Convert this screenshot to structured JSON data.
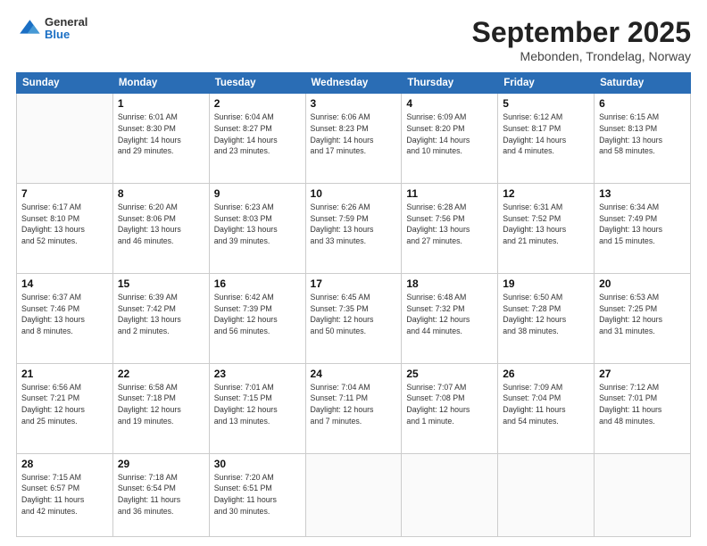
{
  "header": {
    "logo_general": "General",
    "logo_blue": "Blue",
    "month": "September 2025",
    "location": "Mebonden, Trondelag, Norway"
  },
  "weekdays": [
    "Sunday",
    "Monday",
    "Tuesday",
    "Wednesday",
    "Thursday",
    "Friday",
    "Saturday"
  ],
  "weeks": [
    [
      {
        "day": "",
        "info": ""
      },
      {
        "day": "1",
        "info": "Sunrise: 6:01 AM\nSunset: 8:30 PM\nDaylight: 14 hours\nand 29 minutes."
      },
      {
        "day": "2",
        "info": "Sunrise: 6:04 AM\nSunset: 8:27 PM\nDaylight: 14 hours\nand 23 minutes."
      },
      {
        "day": "3",
        "info": "Sunrise: 6:06 AM\nSunset: 8:23 PM\nDaylight: 14 hours\nand 17 minutes."
      },
      {
        "day": "4",
        "info": "Sunrise: 6:09 AM\nSunset: 8:20 PM\nDaylight: 14 hours\nand 10 minutes."
      },
      {
        "day": "5",
        "info": "Sunrise: 6:12 AM\nSunset: 8:17 PM\nDaylight: 14 hours\nand 4 minutes."
      },
      {
        "day": "6",
        "info": "Sunrise: 6:15 AM\nSunset: 8:13 PM\nDaylight: 13 hours\nand 58 minutes."
      }
    ],
    [
      {
        "day": "7",
        "info": "Sunrise: 6:17 AM\nSunset: 8:10 PM\nDaylight: 13 hours\nand 52 minutes."
      },
      {
        "day": "8",
        "info": "Sunrise: 6:20 AM\nSunset: 8:06 PM\nDaylight: 13 hours\nand 46 minutes."
      },
      {
        "day": "9",
        "info": "Sunrise: 6:23 AM\nSunset: 8:03 PM\nDaylight: 13 hours\nand 39 minutes."
      },
      {
        "day": "10",
        "info": "Sunrise: 6:26 AM\nSunset: 7:59 PM\nDaylight: 13 hours\nand 33 minutes."
      },
      {
        "day": "11",
        "info": "Sunrise: 6:28 AM\nSunset: 7:56 PM\nDaylight: 13 hours\nand 27 minutes."
      },
      {
        "day": "12",
        "info": "Sunrise: 6:31 AM\nSunset: 7:52 PM\nDaylight: 13 hours\nand 21 minutes."
      },
      {
        "day": "13",
        "info": "Sunrise: 6:34 AM\nSunset: 7:49 PM\nDaylight: 13 hours\nand 15 minutes."
      }
    ],
    [
      {
        "day": "14",
        "info": "Sunrise: 6:37 AM\nSunset: 7:46 PM\nDaylight: 13 hours\nand 8 minutes."
      },
      {
        "day": "15",
        "info": "Sunrise: 6:39 AM\nSunset: 7:42 PM\nDaylight: 13 hours\nand 2 minutes."
      },
      {
        "day": "16",
        "info": "Sunrise: 6:42 AM\nSunset: 7:39 PM\nDaylight: 12 hours\nand 56 minutes."
      },
      {
        "day": "17",
        "info": "Sunrise: 6:45 AM\nSunset: 7:35 PM\nDaylight: 12 hours\nand 50 minutes."
      },
      {
        "day": "18",
        "info": "Sunrise: 6:48 AM\nSunset: 7:32 PM\nDaylight: 12 hours\nand 44 minutes."
      },
      {
        "day": "19",
        "info": "Sunrise: 6:50 AM\nSunset: 7:28 PM\nDaylight: 12 hours\nand 38 minutes."
      },
      {
        "day": "20",
        "info": "Sunrise: 6:53 AM\nSunset: 7:25 PM\nDaylight: 12 hours\nand 31 minutes."
      }
    ],
    [
      {
        "day": "21",
        "info": "Sunrise: 6:56 AM\nSunset: 7:21 PM\nDaylight: 12 hours\nand 25 minutes."
      },
      {
        "day": "22",
        "info": "Sunrise: 6:58 AM\nSunset: 7:18 PM\nDaylight: 12 hours\nand 19 minutes."
      },
      {
        "day": "23",
        "info": "Sunrise: 7:01 AM\nSunset: 7:15 PM\nDaylight: 12 hours\nand 13 minutes."
      },
      {
        "day": "24",
        "info": "Sunrise: 7:04 AM\nSunset: 7:11 PM\nDaylight: 12 hours\nand 7 minutes."
      },
      {
        "day": "25",
        "info": "Sunrise: 7:07 AM\nSunset: 7:08 PM\nDaylight: 12 hours\nand 1 minute."
      },
      {
        "day": "26",
        "info": "Sunrise: 7:09 AM\nSunset: 7:04 PM\nDaylight: 11 hours\nand 54 minutes."
      },
      {
        "day": "27",
        "info": "Sunrise: 7:12 AM\nSunset: 7:01 PM\nDaylight: 11 hours\nand 48 minutes."
      }
    ],
    [
      {
        "day": "28",
        "info": "Sunrise: 7:15 AM\nSunset: 6:57 PM\nDaylight: 11 hours\nand 42 minutes."
      },
      {
        "day": "29",
        "info": "Sunrise: 7:18 AM\nSunset: 6:54 PM\nDaylight: 11 hours\nand 36 minutes."
      },
      {
        "day": "30",
        "info": "Sunrise: 7:20 AM\nSunset: 6:51 PM\nDaylight: 11 hours\nand 30 minutes."
      },
      {
        "day": "",
        "info": ""
      },
      {
        "day": "",
        "info": ""
      },
      {
        "day": "",
        "info": ""
      },
      {
        "day": "",
        "info": ""
      }
    ]
  ]
}
